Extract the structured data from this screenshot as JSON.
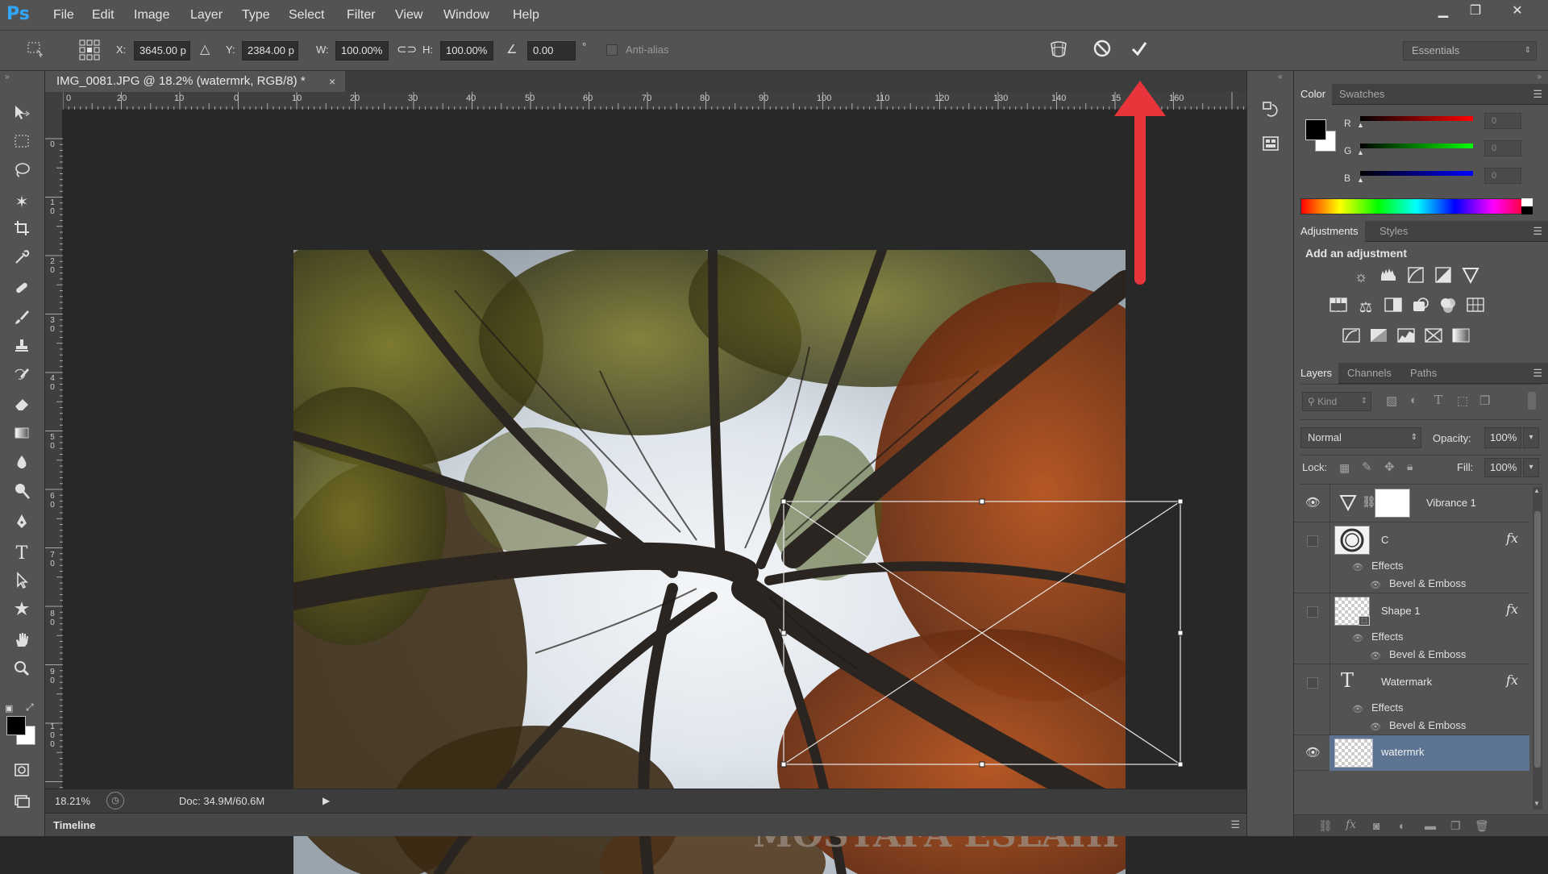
{
  "app": {
    "logo": "Ps"
  },
  "menu": [
    "File",
    "Edit",
    "Image",
    "Layer",
    "Type",
    "Select",
    "Filter",
    "View",
    "Window",
    "Help"
  ],
  "window_controls": {
    "minimize": "▁",
    "restore": "❐",
    "close": "✕"
  },
  "options": {
    "x_label": "X:",
    "x_value": "3645.00 p",
    "y_label": "Y:",
    "y_value": "2384.00 p",
    "w_label": "W:",
    "w_value": "100.00%",
    "h_label": "H:",
    "h_value": "100.00%",
    "angle_value": "0.00",
    "degree": "°",
    "antialias_label": "Anti-alias",
    "workspace": "Essentials"
  },
  "document": {
    "tab_title": "IMG_0081.JPG @ 18.2% (watermrk, RGB/8) *",
    "close": "×",
    "watermark_text": "MOSTAFA ESLAHI"
  },
  "ruler_top": [
    "0",
    "20",
    "10",
    "0",
    "10",
    "20",
    "30",
    "40",
    "50",
    "60",
    "70",
    "80",
    "90",
    "100",
    "110",
    "120",
    "130",
    "140",
    "15",
    "160"
  ],
  "ruler_left": [
    "0",
    "1\n0",
    "2\n0",
    "3\n0",
    "4\n0",
    "5\n0",
    "6\n0",
    "7\n0",
    "8\n0",
    "9\n0",
    "1\n0\n0"
  ],
  "status": {
    "zoom": "18.21%",
    "doc": "Doc: 34.9M/60.6M"
  },
  "timeline": {
    "label": "Timeline"
  },
  "color_panel": {
    "tabs": [
      "Color",
      "Swatches"
    ],
    "channels": [
      {
        "label": "R",
        "value": "0"
      },
      {
        "label": "G",
        "value": "0"
      },
      {
        "label": "B",
        "value": "0"
      }
    ]
  },
  "adjustments_panel": {
    "tabs": [
      "Adjustments",
      "Styles"
    ],
    "heading": "Add an adjustment"
  },
  "layers_panel": {
    "tabs": [
      "Layers",
      "Channels",
      "Paths"
    ],
    "kind_label": "Kind",
    "blend_mode": "Normal",
    "opacity_label": "Opacity:",
    "opacity_value": "100%",
    "lock_label": "Lock:",
    "fill_label": "Fill:",
    "fill_value": "100%",
    "layers": [
      {
        "name": "Vibrance 1"
      },
      {
        "name": "C",
        "effects": "Effects",
        "effect": "Bevel & Emboss"
      },
      {
        "name": "Shape 1",
        "effects": "Effects",
        "effect": "Bevel & Emboss"
      },
      {
        "name": "Watermark",
        "effects": "Effects",
        "effect": "Bevel & Emboss"
      },
      {
        "name": "watermrk"
      }
    ]
  },
  "colors": {
    "accent_arrow": "#e8343b",
    "selection_row": "#5d7392",
    "panel_bg": "#535353"
  }
}
